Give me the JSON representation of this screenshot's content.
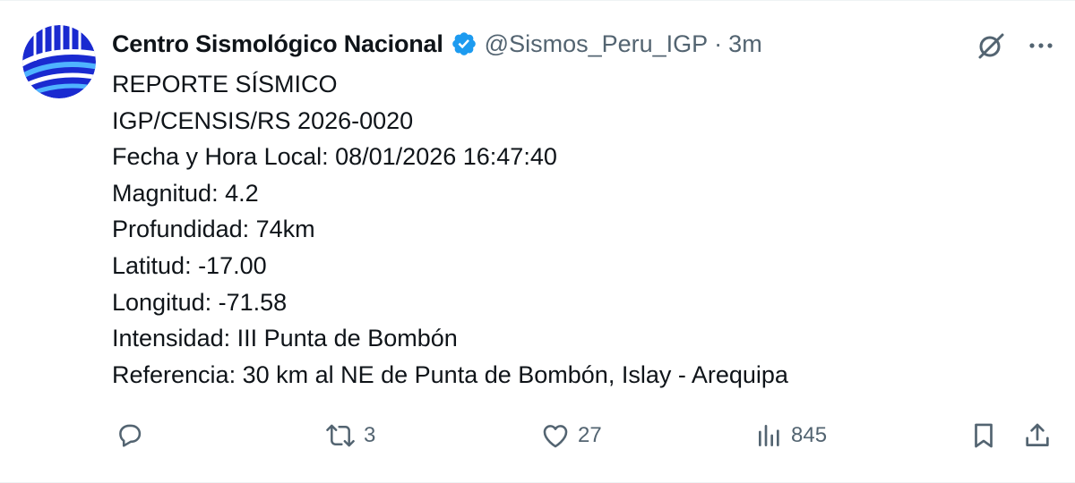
{
  "tweet": {
    "author_name": "Centro Sismológico Nacional",
    "handle": "@Sismos_Peru_IGP",
    "separator": "·",
    "time": "3m",
    "lines": [
      "REPORTE SÍSMICO",
      "IGP/CENSIS/RS 2026-0020",
      "Fecha y Hora Local: 08/01/2026 16:47:40",
      "Magnitud: 4.2",
      "Profundidad: 74km",
      "Latitud: -17.00",
      "Longitud: -71.58",
      "Intensidad: III Punta de Bombón",
      "Referencia: 30 km al NE de Punta de Bombón, Islay - Arequipa"
    ]
  },
  "actions": {
    "reply_count": "",
    "retweet_count": "3",
    "like_count": "27",
    "views_count": "845"
  },
  "icons": {
    "avatar": "igp-logo-icon",
    "verified": "verified-badge-icon",
    "grok": "grok-icon",
    "more": "more-icon",
    "reply": "reply-icon",
    "retweet": "retweet-icon",
    "like": "heart-icon",
    "views": "views-icon",
    "bookmark": "bookmark-icon",
    "share": "share-icon"
  },
  "colors": {
    "text": "#0f1419",
    "secondary": "#536471",
    "verified": "#1d9bf0",
    "logo_blue": "#1a2ad0"
  }
}
